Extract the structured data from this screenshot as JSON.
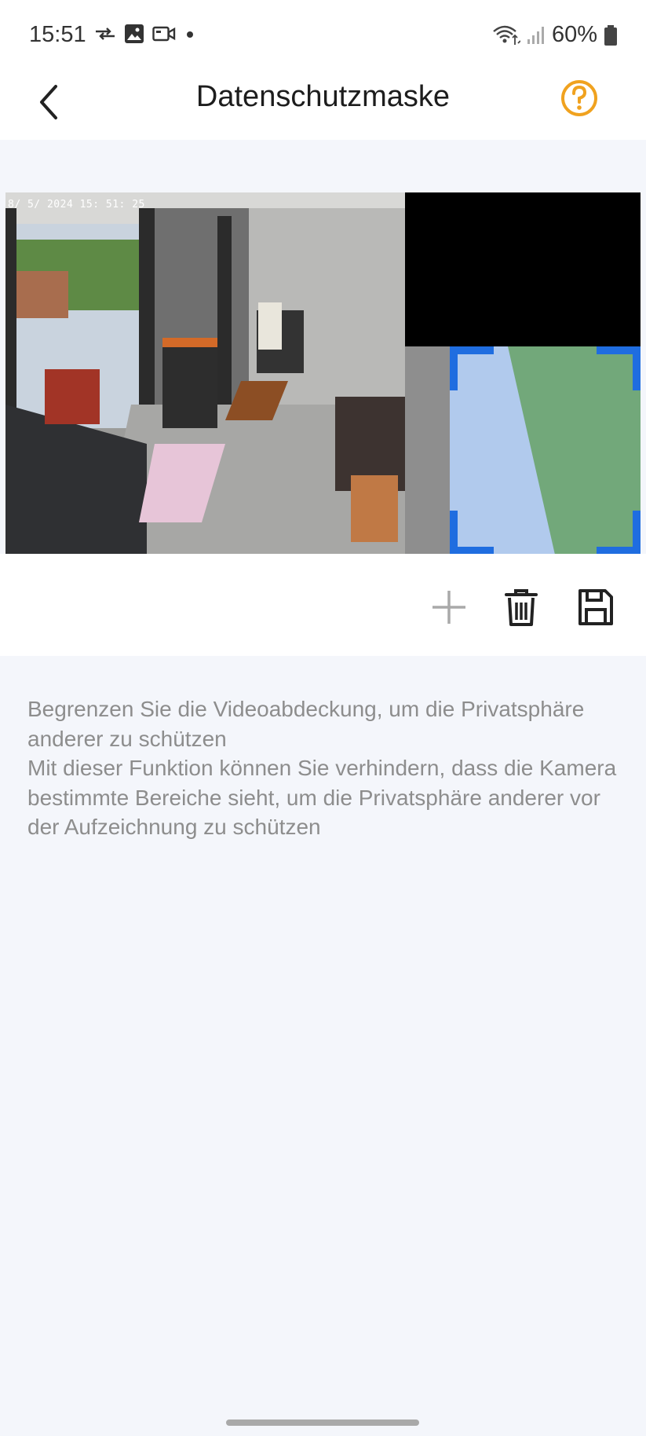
{
  "status_bar": {
    "time": "15:51",
    "battery": "60%",
    "icons": [
      "data-transfer-icon",
      "image-icon",
      "video-icon",
      "dot-icon",
      "wifi-icon",
      "signal-icon",
      "battery-icon"
    ]
  },
  "header": {
    "title": "Datenschutzmaske",
    "back_icon": "chevron-left-icon",
    "help_icon": "help-circle-icon",
    "accent_color": "#f0a21f"
  },
  "camera": {
    "timestamp": "8/ 5/ 2024  15: 51: 25",
    "selection_color": "#1f6de0"
  },
  "toolbar": {
    "add_icon": "plus-icon",
    "delete_icon": "trash-icon",
    "save_icon": "save-icon"
  },
  "description": {
    "line1": "Begrenzen Sie die Videoabdeckung, um die Privatsphäre anderer zu schützen",
    "line2": "Mit dieser Funktion können Sie verhindern, dass die Kamera bestimmte Bereiche sieht, um die Privatsphäre anderer vor der Aufzeichnung zu schützen"
  }
}
